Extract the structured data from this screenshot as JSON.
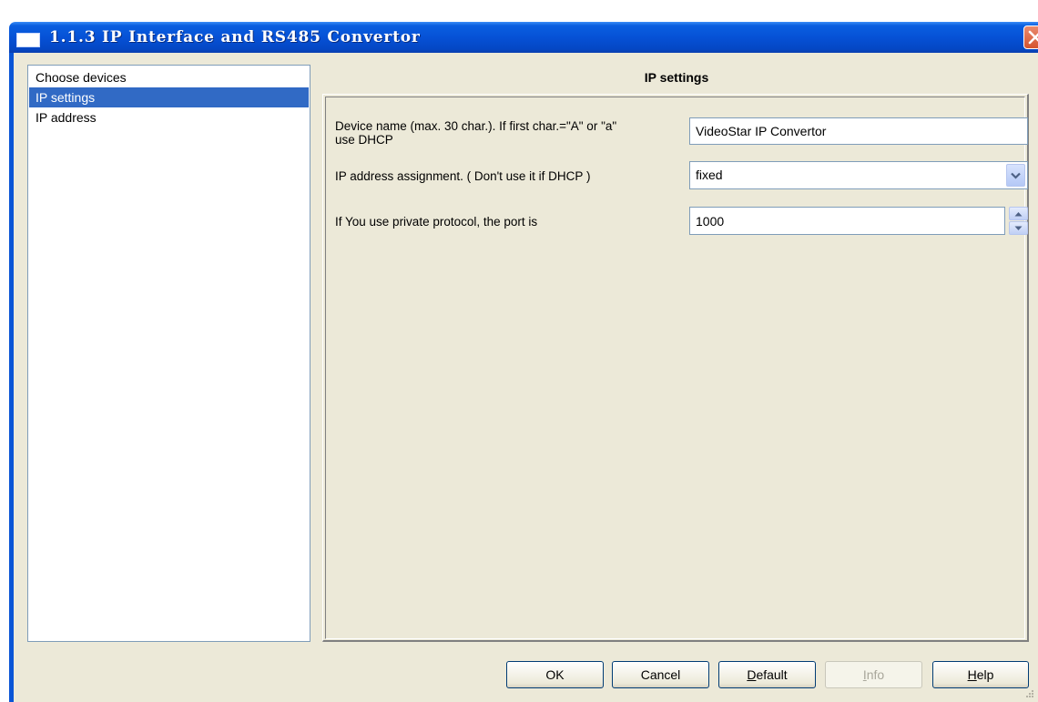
{
  "window": {
    "title": "1.1.3 IP Interface and RS485 Convertor"
  },
  "sidebar": {
    "items": [
      {
        "label": "Choose devices",
        "selected": false
      },
      {
        "label": "IP settings",
        "selected": true
      },
      {
        "label": "IP address",
        "selected": false
      }
    ]
  },
  "main": {
    "title": "IP settings",
    "params": [
      {
        "label_line1": "Device name (max. 30 char.).  If first char.=\"A\" or \"a\"",
        "label_line2": "use DHCP",
        "value": "VideoStar IP Convertor",
        "type": "text"
      },
      {
        "label": "IP address assignment. ( Don't use it if DHCP )",
        "value": "fixed",
        "type": "select"
      },
      {
        "label": "If You use private protocol, the port is",
        "value": "1000",
        "type": "spin"
      }
    ]
  },
  "buttons": {
    "ok": "OK",
    "cancel": "Cancel",
    "default_mnemonic": "D",
    "default_rest": "efault",
    "info_mnemonic": "I",
    "info_rest": "nfo",
    "help_mnemonic": "H",
    "help_rest": "elp"
  },
  "colors": {
    "titlebar": "#0651d6",
    "selection": "#316ac5",
    "face": "#ece9d8"
  }
}
